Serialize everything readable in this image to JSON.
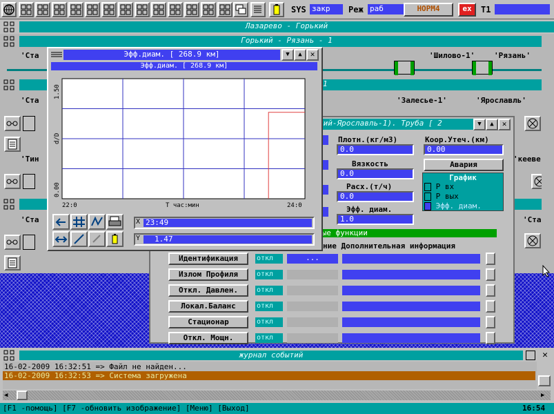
{
  "toolbar": {
    "sys_label": "SYS",
    "sys_value": "закр",
    "mode_label": "Реж",
    "mode_value": "раб",
    "norm_button": "НОРМ4",
    "ex_button": "ex",
    "t1_label": "T1"
  },
  "windows": {
    "w1_title": "Лазарево - Горький",
    "w2_title": "Горький - Рязань - 1",
    "w3_title_tail": "1",
    "w4_title": "кий-Ярославль-1). Труба [ 2",
    "w5_title_tail": "",
    "stations_row1": [
      "'Ста",
      "'Шилово-1'",
      "'Рязань'"
    ],
    "stations_row2": [
      "'Ста",
      "'Залесье-1'",
      "'Ярославль'"
    ],
    "stations_row3": [
      "'Тин",
      "'кееве'"
    ],
    "stations_row4": [
      "'Ста",
      "'Ста"
    ]
  },
  "chart_window": {
    "header_title": "Эфф.диам. [ 268.9 км]",
    "inner_title": "Эфф.диам. [ 268.9 км]",
    "x_readout_label": "X",
    "x_readout_value": "23:49",
    "y_readout_label": "Y",
    "y_readout_value": "1.47"
  },
  "chart_data": {
    "type": "line",
    "xlabel": "Т час:мин",
    "ylabel": "d/D",
    "x_ticks": [
      "22:0",
      "24:0"
    ],
    "y_ticks": [
      "0.00",
      "1.50"
    ],
    "ylim": [
      0,
      1.5
    ],
    "xlim": [
      "22:00",
      "24:00"
    ],
    "grid": true,
    "series": [
      {
        "points": [
          [
            "23:42",
            0.0
          ],
          [
            "23:42",
            1.08
          ],
          [
            "24:00",
            1.08
          ]
        ],
        "color": "#e04040"
      }
    ]
  },
  "params": {
    "density_label": "Плотн.(кг/м3)",
    "density_value": "0.0",
    "viscosity_label": "Вязкость",
    "viscosity_value": "0.0",
    "flow_label": "Расх.(т/ч)",
    "flow_value": "0.0",
    "eff_diam_label": "Эфф. диам.",
    "eff_diam_value": "1.0",
    "leak_coord_label": "Коор.Утеч.(км)",
    "leak_coord_value": "0.00",
    "alarm_button": "Авария",
    "graph_title": "График",
    "graph_items": [
      "Р вх",
      "Р вых",
      "Эфф. диам."
    ]
  },
  "functions": {
    "panel_title": "ные функции",
    "info_header": "ние Дополнительная информация",
    "rows": [
      {
        "name": "Идентификация",
        "state": "откл",
        "extra": "..."
      },
      {
        "name": "Излом Профиля",
        "state": "откл",
        "extra": ""
      },
      {
        "name": "Откл. Давлен.",
        "state": "откл",
        "extra": ""
      },
      {
        "name": "Локал.Баланс",
        "state": "откл",
        "extra": ""
      },
      {
        "name": "Стационар",
        "state": "откл",
        "extra": ""
      },
      {
        "name": "Откл. Мощн.",
        "state": "откл",
        "extra": ""
      }
    ]
  },
  "journal": {
    "title": "журнал событий",
    "entries": [
      "16-02-2009 16:32:51 => Файл не найден...",
      "16-02-2009 16:32:53 => Система загружена"
    ]
  },
  "statusbar": {
    "help_text": "[F1 -помощь] [F7 -обновить изображение] [Меню] [Выход]",
    "clock": "16:54"
  },
  "colors": {
    "teal": "#00a0a0",
    "blue": "#4040f0",
    "alarm_red": "#e02020",
    "journal_highlight": "#b06000"
  }
}
